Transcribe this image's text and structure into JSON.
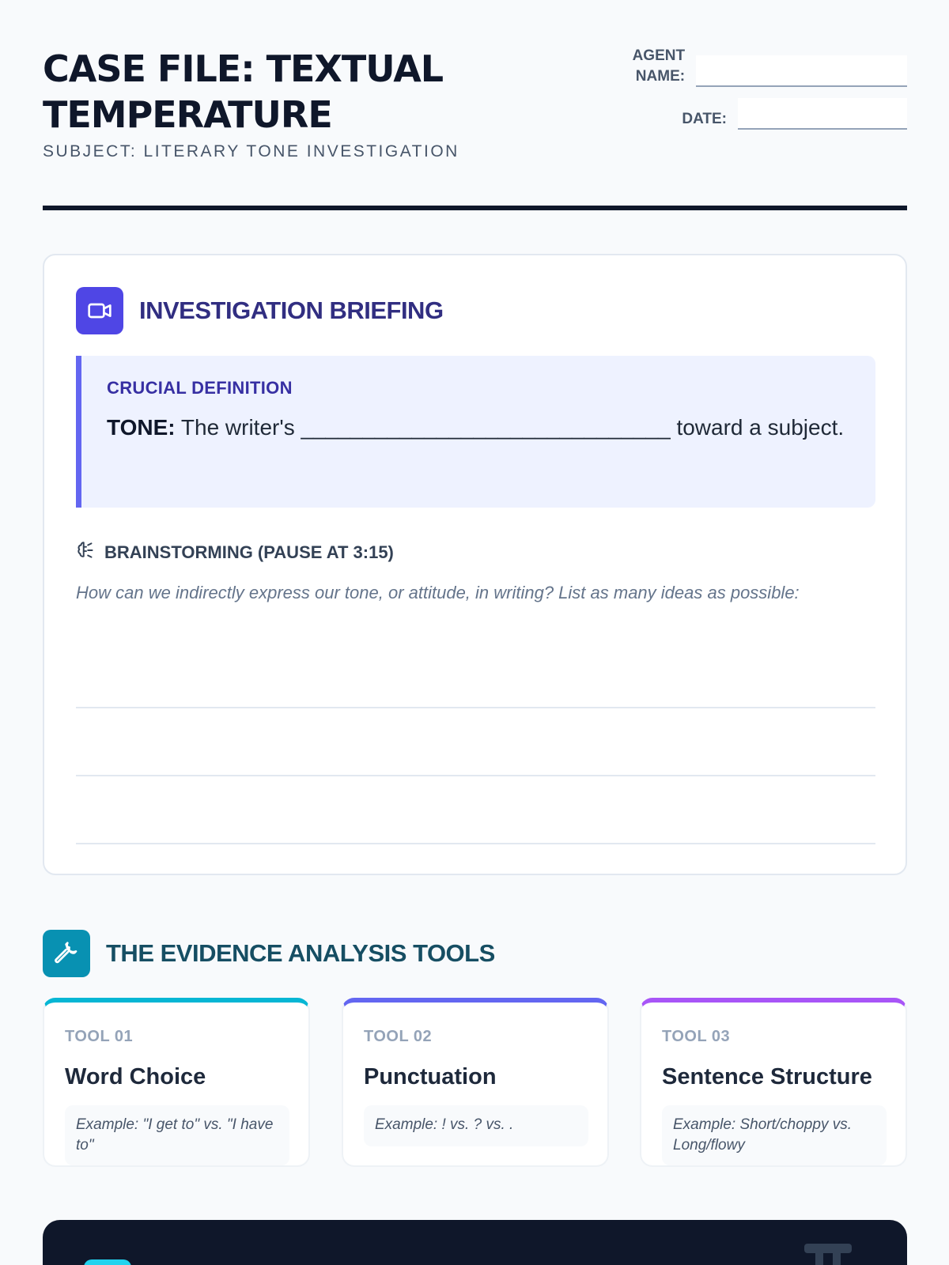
{
  "header": {
    "title": "CASE FILE: TEXTUAL TEMPERATURE",
    "subtitle": "SUBJECT: LITERARY TONE INVESTIGATION",
    "agent_label": "AGENT NAME:",
    "date_label": "DATE:"
  },
  "briefing": {
    "icon": "video-camera-icon",
    "title": "INVESTIGATION BRIEFING",
    "definition": {
      "label": "CRUCIAL DEFINITION",
      "term": "TONE:",
      "before_blank": "The writer's",
      "blank": "______________________________",
      "after_blank": "toward a subject."
    },
    "brainstorm": {
      "icon": "brain-icon",
      "title": "BRAINSTORMING (PAUSE AT 3:15)",
      "question": "How can we indirectly express our tone, or attitude, in writing? List as many ideas as possible:"
    }
  },
  "tools": {
    "icon": "wrench-icon",
    "title": "THE EVIDENCE ANALYSIS TOOLS",
    "items": [
      {
        "number": "TOOL 01",
        "name": "Word Choice",
        "example": "Example: \"I get to\" vs. \"I have to\"",
        "accent": "#06b6d4"
      },
      {
        "number": "TOOL 02",
        "name": "Punctuation",
        "example": "Example: ! vs. ? vs. .",
        "accent": "#6366f1"
      },
      {
        "number": "TOOL 03",
        "name": "Sentence Structure",
        "example": "Example: Short/choppy vs. Long/flowy",
        "accent": "#a855f7"
      }
    ]
  },
  "colors": {
    "ink": "#0f172a",
    "indigo": "#4f46e5",
    "cyan": "#0891b2",
    "definition_bg": "#eef2ff"
  }
}
